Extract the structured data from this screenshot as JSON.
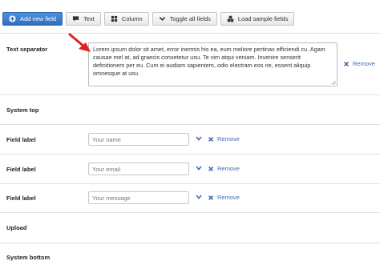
{
  "toolbar": {
    "add_new_field": "Add new field",
    "text": "Text",
    "column": "Column",
    "toggle_all_fields": "Toggle all fields",
    "load_sample_fields": "Load sample fields"
  },
  "rows": {
    "text_separator": {
      "label": "Text separator",
      "value": "Lorem ipsum dolor sit amet, error inermis his ea, eum meliore pertinax efficiendi cu. Agam causae mel at, ad graecis consetetur usu. Te vim atqui veniam. Invenire senserit definitionem per eu. Cum ei audiam sapientem, odio electram eos ne, essent aliquip omnesque at usu.",
      "remove": "Remove"
    },
    "system_top": {
      "label": "System top"
    },
    "field1": {
      "label": "Field label",
      "value": "Your name",
      "remove": "Remove"
    },
    "field2": {
      "label": "Field label",
      "value": "Your email",
      "remove": "Remove"
    },
    "field3": {
      "label": "Field label",
      "value": "Your message",
      "remove": "Remove"
    },
    "upload": {
      "label": "Upload"
    },
    "system_bottom": {
      "label": "System bottom"
    }
  },
  "colors": {
    "primary": "#2f6fc0",
    "link": "#3b6eb0",
    "arrow": "#e02020",
    "separator": "#e1e1e1"
  },
  "icons": {
    "add": "plus-circle-icon",
    "text": "comment-icon",
    "column": "grid-icon",
    "toggle": "chevron-down-icon",
    "sample": "cubes-icon",
    "remove": "close-icon"
  }
}
